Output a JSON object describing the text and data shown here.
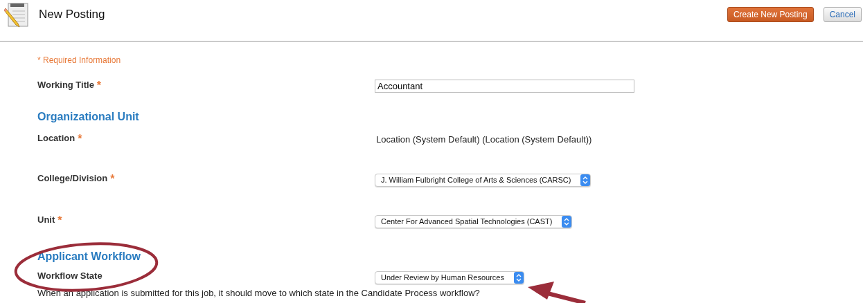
{
  "header": {
    "title": "New Posting",
    "buttons": [
      {
        "label": "Create New Posting",
        "kind": "primary"
      },
      {
        "label": "Cancel",
        "kind": "secondary"
      }
    ]
  },
  "required_note": "* Required Information",
  "rows": [
    {
      "kind": "field",
      "label": "Working Title",
      "required_mark": "*",
      "value": "Accountant"
    },
    {
      "kind": "heading",
      "label": "Organizational Unit"
    },
    {
      "kind": "static",
      "label": "Location",
      "required_mark": "*",
      "value": "Location (System Default) (Location (System Default))"
    },
    {
      "kind": "select",
      "label": "College/Division",
      "required_mark": "*",
      "value": "J. William Fulbright College of Arts & Sciences (CARSC)"
    },
    {
      "kind": "select",
      "label": "Unit",
      "required_mark": "*",
      "value": "Center For Advanced Spatial Technologies (CAST)"
    },
    {
      "kind": "heading",
      "label": "Applicant Workflow"
    },
    {
      "kind": "select",
      "label": "Workflow State",
      "value": "Under Review by Human Resources"
    }
  ],
  "help_text": "When an application is submitted for this job, it should move to which state in the Candidate Process workflow?"
}
